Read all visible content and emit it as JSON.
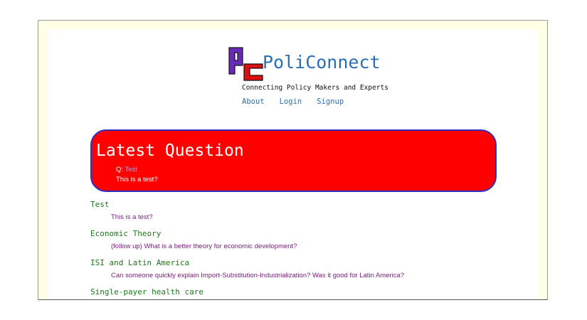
{
  "header": {
    "site_name": "PoliConnect",
    "logo_icon": "pc-logo-icon",
    "tagline": "Connecting Policy Makers and Experts",
    "nav": [
      {
        "label": "About"
      },
      {
        "label": "Login"
      },
      {
        "label": "Signup"
      }
    ]
  },
  "latest": {
    "heading": "Latest Question",
    "q_prefix": "Q:",
    "q_title": "Test",
    "q_body": "This is a test?"
  },
  "questions": [
    {
      "title": "Test",
      "body": "This is a test?"
    },
    {
      "title": "Economic Theory",
      "body": "(follow up) What is a better theory for economic development?"
    },
    {
      "title": "ISI and Latin America",
      "body": "Can someone quickly explain Import-Substitution-Industrialization? Was it good for Latin America?"
    },
    {
      "title": "Single-payer health care",
      "body": ""
    }
  ],
  "colors": {
    "banner": "#ff0000",
    "banner_border": "#3030c0",
    "link": "#2c6fb5",
    "question_title": "#1a7a1a",
    "question_body": "#7a1a7a",
    "page_bg": "#ffffe6"
  }
}
